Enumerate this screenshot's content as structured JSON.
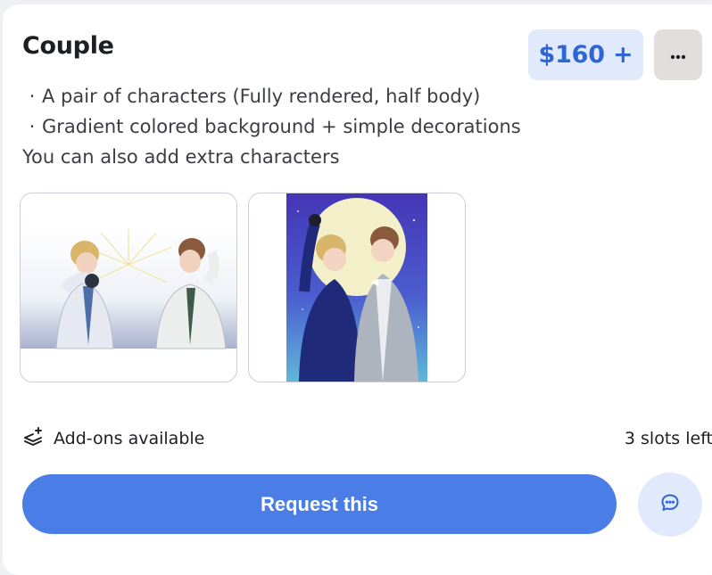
{
  "card": {
    "title": "Couple",
    "price": "$160 +",
    "description": {
      "bullets": [
        "A pair of characters (Fully rendered, half body)",
        "Gradient colored background + simple decorations"
      ],
      "note": "You can also add extra characters"
    },
    "gallery": [
      {
        "alt": "Two characters, one shading eyes from the sun"
      },
      {
        "alt": "Two characters embracing under a full moon"
      }
    ],
    "addons_label": "Add-ons available",
    "slots_label": "3 slots left",
    "request_label": "Request this",
    "icons": {
      "more": "more-horizontal-icon",
      "addons": "layers-plus-icon",
      "chat": "chat-bubble-icon"
    }
  },
  "colors": {
    "primary": "#4a7ee6",
    "price_text": "#2e66d6",
    "price_bg": "#e1eafc",
    "more_bg": "#e3dede"
  }
}
